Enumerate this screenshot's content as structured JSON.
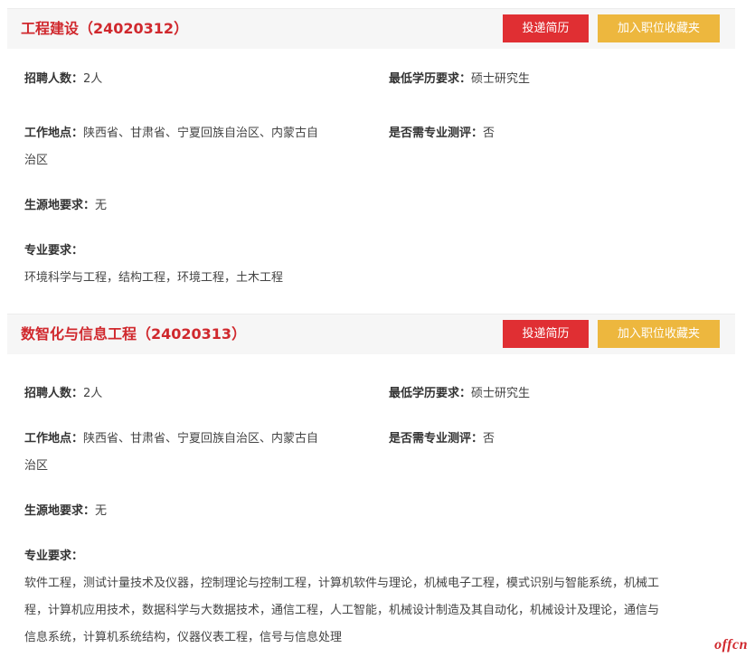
{
  "jobs": [
    {
      "title": "工程建设（24020312）",
      "apply_label": "投递简历",
      "favorite_label": "加入职位收藏夹",
      "headcount_label": "招聘人数：",
      "headcount_value": "2人",
      "education_label": "最低学历要求：",
      "education_value": "硕士研究生",
      "location_label": "工作地点：",
      "location_value_line1": "陕西省、甘肃省、宁夏回族自治区、内蒙古自",
      "location_value_line2": "治区",
      "test_label": "是否需专业测评：",
      "test_value": "否",
      "origin_label": "生源地要求：",
      "origin_value": "无",
      "major_label": "专业要求：",
      "major_value": "环境科学与工程，结构工程，环境工程，土木工程"
    },
    {
      "title": "数智化与信息工程（24020313）",
      "apply_label": "投递简历",
      "favorite_label": "加入职位收藏夹",
      "headcount_label": "招聘人数：",
      "headcount_value": "2人",
      "education_label": "最低学历要求：",
      "education_value": "硕士研究生",
      "location_label": "工作地点：",
      "location_value_line1": "陕西省、甘肃省、宁夏回族自治区、内蒙古自",
      "location_value_line2": "治区",
      "test_label": "是否需专业测评：",
      "test_value": "否",
      "origin_label": "生源地要求：",
      "origin_value": "无",
      "major_label": "专业要求：",
      "major_value_line1": "软件工程，测试计量技术及仪器，控制理论与控制工程，计算机软件与理论，机械电子工程，模式识别与智能系统，机械工",
      "major_value_line2": "程，计算机应用技术，数据科学与大数据技术，通信工程，人工智能，机械设计制造及其自动化，机械设计及理论，通信与",
      "major_value_line3": "信息系统，计算机系统结构，仪器仪表工程，信号与信息处理"
    }
  ],
  "watermark": "offcn",
  "colors": {
    "title_red": "#d0282d",
    "apply_button": "#e02f33",
    "favorite_button": "#edb73e",
    "header_bg": "#f6f6f6"
  }
}
